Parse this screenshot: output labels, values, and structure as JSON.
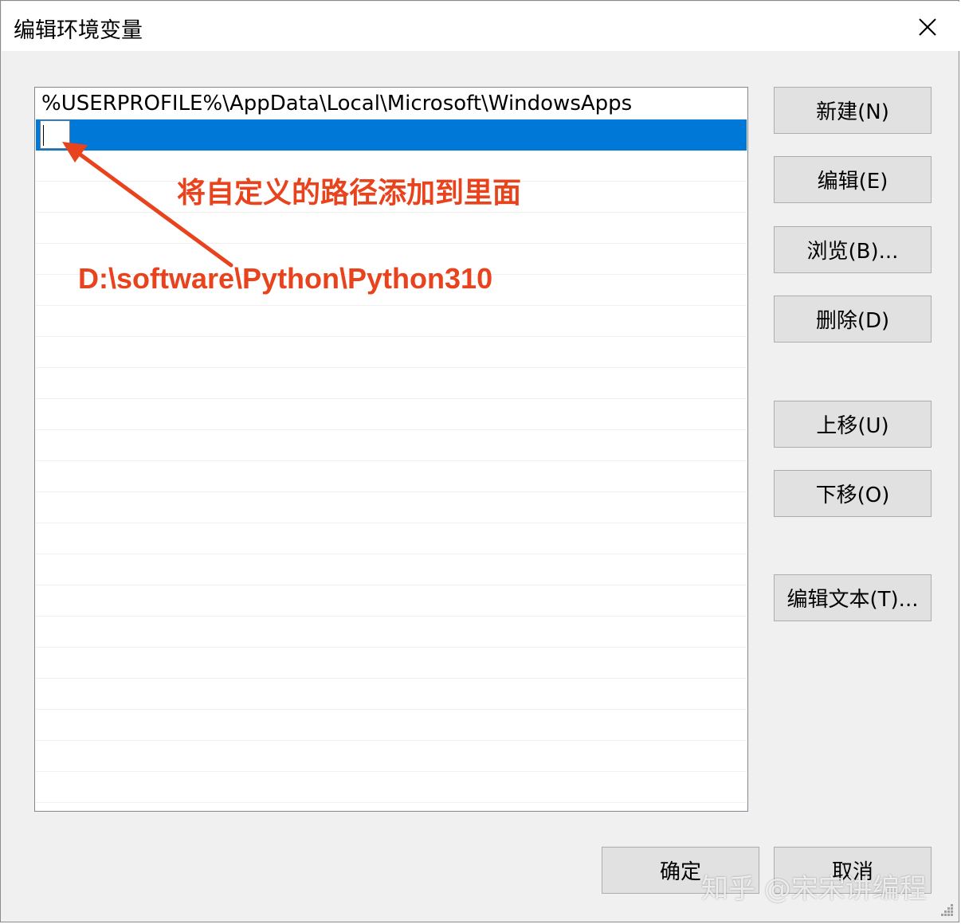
{
  "dialog": {
    "title": "编辑环境变量",
    "close_glyph": "✕"
  },
  "list": {
    "entries": [
      "%USERPROFILE%\\AppData\\Local\\Microsoft\\WindowsApps",
      ""
    ],
    "selected_index": 1,
    "accent_color": "#0078d7"
  },
  "buttons": {
    "new": "新建(N)",
    "edit": "编辑(E)",
    "browse": "浏览(B)...",
    "delete": "删除(D)",
    "move_up": "上移(U)",
    "move_down": "下移(O)",
    "edit_text": "编辑文本(T)...",
    "ok": "确定",
    "cancel": "取消"
  },
  "annotation": {
    "instruction": "将自定义的路径添加到里面",
    "path": "D:\\software\\Python\\Python310",
    "color": "#e8431d"
  },
  "watermark": "知乎 @宋宋讲编程",
  "icons": {
    "close": "close-icon",
    "arrow": "annotation-arrow-icon",
    "resize": "resize-grip-icon"
  }
}
